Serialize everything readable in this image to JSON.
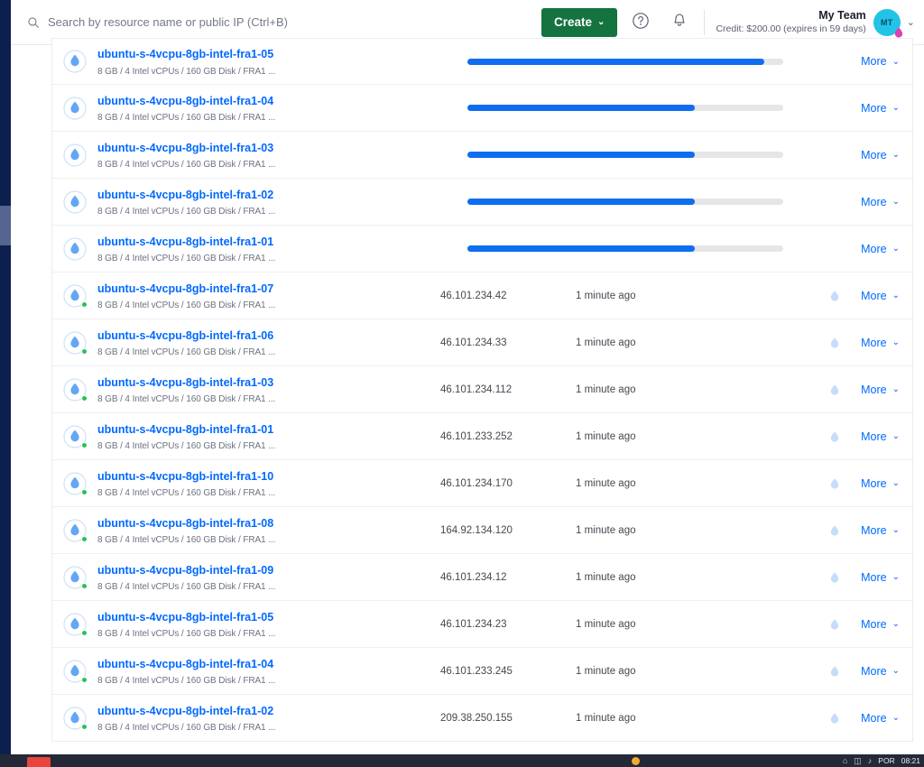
{
  "header": {
    "search": {
      "placeholder": "Search by resource name or public IP (Ctrl+B)",
      "value": "",
      "icon": "search-icon"
    },
    "create_label": "Create",
    "create_chevron": "⌄",
    "help_icon": "help-circle-icon",
    "bell_icon": "bell-icon",
    "team_name": "My Team",
    "team_credit": "Credit: $200.00 (expires in 59 days)",
    "avatar_initials": "MT",
    "avatar_chevron": "⌄",
    "colors": {
      "create_green": "#15733f",
      "link_blue": "#0069ff",
      "avatar_cyan": "#22c3e6",
      "badge_pink": "#e040b0"
    }
  },
  "list": {
    "more_label": "More",
    "more_chevron": "⌄",
    "spec_line": "8 GB / 4 Intel vCPUs / 160 GB Disk / FRA1 ...",
    "rows": [
      {
        "name": "ubuntu-s-4vcpu-8gb-intel-fra1-05",
        "spec": "8 GB / 4 Intel vCPUs / 160 GB Disk / FRA1 ...",
        "type": "progress",
        "progress": 94,
        "status": "creating"
      },
      {
        "name": "ubuntu-s-4vcpu-8gb-intel-fra1-04",
        "spec": "8 GB / 4 Intel vCPUs / 160 GB Disk / FRA1 ...",
        "type": "progress",
        "progress": 72,
        "status": "creating"
      },
      {
        "name": "ubuntu-s-4vcpu-8gb-intel-fra1-03",
        "spec": "8 GB / 4 Intel vCPUs / 160 GB Disk / FRA1 ...",
        "type": "progress",
        "progress": 72,
        "status": "creating"
      },
      {
        "name": "ubuntu-s-4vcpu-8gb-intel-fra1-02",
        "spec": "8 GB / 4 Intel vCPUs / 160 GB Disk / FRA1 ...",
        "type": "progress",
        "progress": 72,
        "status": "creating"
      },
      {
        "name": "ubuntu-s-4vcpu-8gb-intel-fra1-01",
        "spec": "8 GB / 4 Intel vCPUs / 160 GB Disk / FRA1 ...",
        "type": "progress",
        "progress": 72,
        "status": "creating"
      },
      {
        "name": "ubuntu-s-4vcpu-8gb-intel-fra1-07",
        "spec": "8 GB / 4 Intel vCPUs / 160 GB Disk / FRA1 ...",
        "type": "active",
        "ip": "46.101.234.42",
        "created": "1 minute ago",
        "status": "active"
      },
      {
        "name": "ubuntu-s-4vcpu-8gb-intel-fra1-06",
        "spec": "8 GB / 4 Intel vCPUs / 160 GB Disk / FRA1 ...",
        "type": "active",
        "ip": "46.101.234.33",
        "created": "1 minute ago",
        "status": "active"
      },
      {
        "name": "ubuntu-s-4vcpu-8gb-intel-fra1-03",
        "spec": "8 GB / 4 Intel vCPUs / 160 GB Disk / FRA1 ...",
        "type": "active",
        "ip": "46.101.234.112",
        "created": "1 minute ago",
        "status": "active"
      },
      {
        "name": "ubuntu-s-4vcpu-8gb-intel-fra1-01",
        "spec": "8 GB / 4 Intel vCPUs / 160 GB Disk / FRA1 ...",
        "type": "active",
        "ip": "46.101.233.252",
        "created": "1 minute ago",
        "status": "active"
      },
      {
        "name": "ubuntu-s-4vcpu-8gb-intel-fra1-10",
        "spec": "8 GB / 4 Intel vCPUs / 160 GB Disk / FRA1 ...",
        "type": "active",
        "ip": "46.101.234.170",
        "created": "1 minute ago",
        "status": "active"
      },
      {
        "name": "ubuntu-s-4vcpu-8gb-intel-fra1-08",
        "spec": "8 GB / 4 Intel vCPUs / 160 GB Disk / FRA1 ...",
        "type": "active",
        "ip": "164.92.134.120",
        "created": "1 minute ago",
        "status": "active"
      },
      {
        "name": "ubuntu-s-4vcpu-8gb-intel-fra1-09",
        "spec": "8 GB / 4 Intel vCPUs / 160 GB Disk / FRA1 ...",
        "type": "active",
        "ip": "46.101.234.12",
        "created": "1 minute ago",
        "status": "active"
      },
      {
        "name": "ubuntu-s-4vcpu-8gb-intel-fra1-05",
        "spec": "8 GB / 4 Intel vCPUs / 160 GB Disk / FRA1 ...",
        "type": "active",
        "ip": "46.101.234.23",
        "created": "1 minute ago",
        "status": "active"
      },
      {
        "name": "ubuntu-s-4vcpu-8gb-intel-fra1-04",
        "spec": "8 GB / 4 Intel vCPUs / 160 GB Disk / FRA1 ...",
        "type": "active",
        "ip": "46.101.233.245",
        "created": "1 minute ago",
        "status": "active"
      },
      {
        "name": "ubuntu-s-4vcpu-8gb-intel-fra1-02",
        "spec": "8 GB / 4 Intel vCPUs / 160 GB Disk / FRA1 ...",
        "type": "active",
        "ip": "209.38.250.155",
        "created": "1 minute ago",
        "status": "active"
      }
    ]
  },
  "taskbar": {
    "language": "POR",
    "clock": "08:21"
  }
}
